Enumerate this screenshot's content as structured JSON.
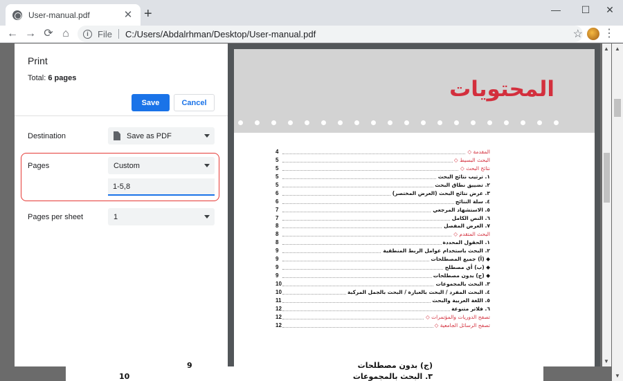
{
  "browser": {
    "tab_title": "User-manual.pdf",
    "tab_close": "✕",
    "new_tab": "+",
    "minimize": "—",
    "maximize": "☐",
    "close": "✕",
    "back": "←",
    "forward": "→",
    "reload": "⟳",
    "home": "⌂",
    "info": "i",
    "url_scheme": "File",
    "url_path": "C:/Users/Abdalrhman/Desktop/User-manual.pdf",
    "bookmark": "☆",
    "menu": "⋮"
  },
  "print_panel": {
    "title": "Print",
    "total_label": "Total: ",
    "total_value": "6 pages",
    "save_label": "Save",
    "cancel_label": "Cancel",
    "destination_label": "Destination",
    "destination_value": "Save as PDF",
    "pages_label": "Pages",
    "pages_value": "Custom",
    "pages_input": "1-5,8",
    "pages_per_sheet_label": "Pages per sheet",
    "pages_per_sheet_value": "1"
  },
  "preview": {
    "heading": "المحتويات",
    "toc": [
      {
        "text": "المقدمة ◇",
        "page": "4",
        "style": "red"
      },
      {
        "text": "البحث البسيط ◇",
        "page": "5",
        "style": "red"
      },
      {
        "text": "نتائج البحث ◇",
        "page": "5",
        "style": "red"
      },
      {
        "text": "١.     ترتيب نتائج البحث",
        "page": "5",
        "style": "blk"
      },
      {
        "text": "٢.   تضييق نطاق البحث",
        "page": "5",
        "style": "blk"
      },
      {
        "text": "٣.   عرض نتائج البحث (العرض المختصر)",
        "page": "6",
        "style": "blk"
      },
      {
        "text": "٤.   سلة النتائج",
        "page": "6",
        "style": "blk"
      },
      {
        "text": "٥.     الاستشهاد المرجعي",
        "page": "7",
        "style": "blk"
      },
      {
        "text": "٦.     النص الكامل",
        "page": "7",
        "style": "blk"
      },
      {
        "text": "٧.   العرض المفصل",
        "page": "8",
        "style": "blk"
      },
      {
        "text": "البحث المتقدم ◇",
        "page": "8",
        "style": "red"
      },
      {
        "text": "١.     الحقول المحددة",
        "page": "8",
        "style": "blk"
      },
      {
        "text": "٢.     البحث باستخدام عوامل الربط المنطقية",
        "page": "9",
        "style": "blk"
      },
      {
        "text": "◆   (أ) جميع المصطلحات",
        "page": "9",
        "style": "blk"
      },
      {
        "text": "◆   (ب) أي مصطلح",
        "page": "9",
        "style": "blk"
      },
      {
        "text": "◆   (ج) بدون مصطلحات",
        "page": "9",
        "style": "blk"
      },
      {
        "text": "٣.   البحث بالمجموعات",
        "page": "10",
        "style": "blk"
      },
      {
        "text": "٤.   البحث المفرد / البحث بالعبارة / البحث بالجمل المركبة",
        "page": "10",
        "style": "blk"
      },
      {
        "text": "٥.   اللغة العربية والبحث",
        "page": "11",
        "style": "blk"
      },
      {
        "text": "٦.   فلاتر متنوعة",
        "page": "12",
        "style": "blk"
      },
      {
        "text": "تصفح الدوريات والمؤتمرات ◇",
        "page": "12",
        "style": "red"
      },
      {
        "text": "تصفح الرسائل الجامعية ◇",
        "page": "12",
        "style": "red"
      }
    ]
  },
  "background_page": {
    "row1_num": "9",
    "row1_text": "(ج) بدون مصطلحات",
    "row2_num": "10",
    "row2_text": "٣.   البحث بالمجموعات"
  },
  "colors": {
    "accent": "#1a73e8",
    "highlight": "#e53935",
    "heading_red": "#d32f3d"
  }
}
